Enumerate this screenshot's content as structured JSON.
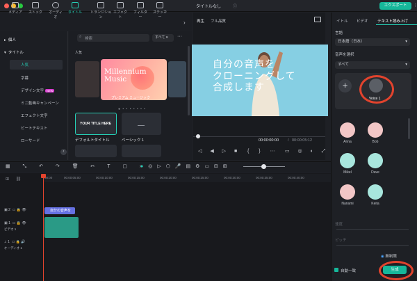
{
  "window": {
    "title": "タイトルなし",
    "export": "エクスポート"
  },
  "toolbar": {
    "items": [
      {
        "label": "メディア",
        "icon": "media-icon"
      },
      {
        "label": "ストック",
        "icon": "stock-icon"
      },
      {
        "label": "オーディオ",
        "icon": "music-icon"
      },
      {
        "label": "タイトル",
        "icon": "title-icon",
        "active": true
      },
      {
        "label": "トランジション",
        "icon": "transition-icon"
      },
      {
        "label": "エフェクト",
        "icon": "effect-icon"
      },
      {
        "label": "フィルター",
        "icon": "filter-icon"
      },
      {
        "label": "ステッカー",
        "icon": "sticker-icon"
      }
    ]
  },
  "categories": {
    "personal": "個人",
    "title": "タイトル",
    "items": [
      "人気",
      "字幕",
      "デザイン文字",
      "ミニ動画キャンペーン",
      "エフェクト文字",
      "ビートテキスト",
      "ローサード"
    ],
    "new_badge": "NEW"
  },
  "grid": {
    "search_placeholder": "検索",
    "filter": "すべて",
    "section": "人気",
    "hero_title_1": "Millennium",
    "hero_title_2": "Music",
    "hero_caption": "プレミアム ミュージック",
    "tiles": [
      {
        "name": "デフォルトタイトル",
        "text": "YOUR TITLE HERE"
      },
      {
        "name": "ベーシック 1"
      }
    ]
  },
  "preview": {
    "play_label": "再生",
    "quality": "フル品質",
    "overlay": [
      "自分の音声を",
      "クローニングして",
      "合成します"
    ],
    "time_current": "00:00:00:00",
    "time_total": "00:00:05:12",
    "time_sep": "/"
  },
  "right_panel": {
    "tabs": [
      "イトル",
      "ビデオ",
      "テキスト読み上げ"
    ],
    "language_label": "言語",
    "language_value": "日本語（日本）",
    "voice_label": "音声を選択",
    "voice_filter": "すべて",
    "custom_voice": "Voice 1",
    "voices": [
      "Anna",
      "Bob",
      "Mikel",
      "Dave",
      "Nanami",
      "Keita"
    ],
    "speed_label": "速度",
    "pitch_label": "ピッチ",
    "unlimited": "無制限",
    "auto_match": "自動一致",
    "generate": "生成"
  },
  "timeline": {
    "ruler": [
      "00:00",
      "00:00:05:00",
      "00:00:10:00",
      "00:00:15:00",
      "00:00:20:00",
      "00:00:25:00",
      "00:00:30:00",
      "00:00:35:00",
      "00:00:40:00"
    ],
    "tracks": [
      {
        "num": "2",
        "label": ""
      },
      {
        "num": "1",
        "label": "ビデオ 1"
      },
      {
        "num": "1",
        "label": "オーディオ 1"
      }
    ],
    "text_clip": "自分の音声を"
  },
  "colors": {
    "accent": "#16b79a",
    "highlight": "#e2432d"
  }
}
